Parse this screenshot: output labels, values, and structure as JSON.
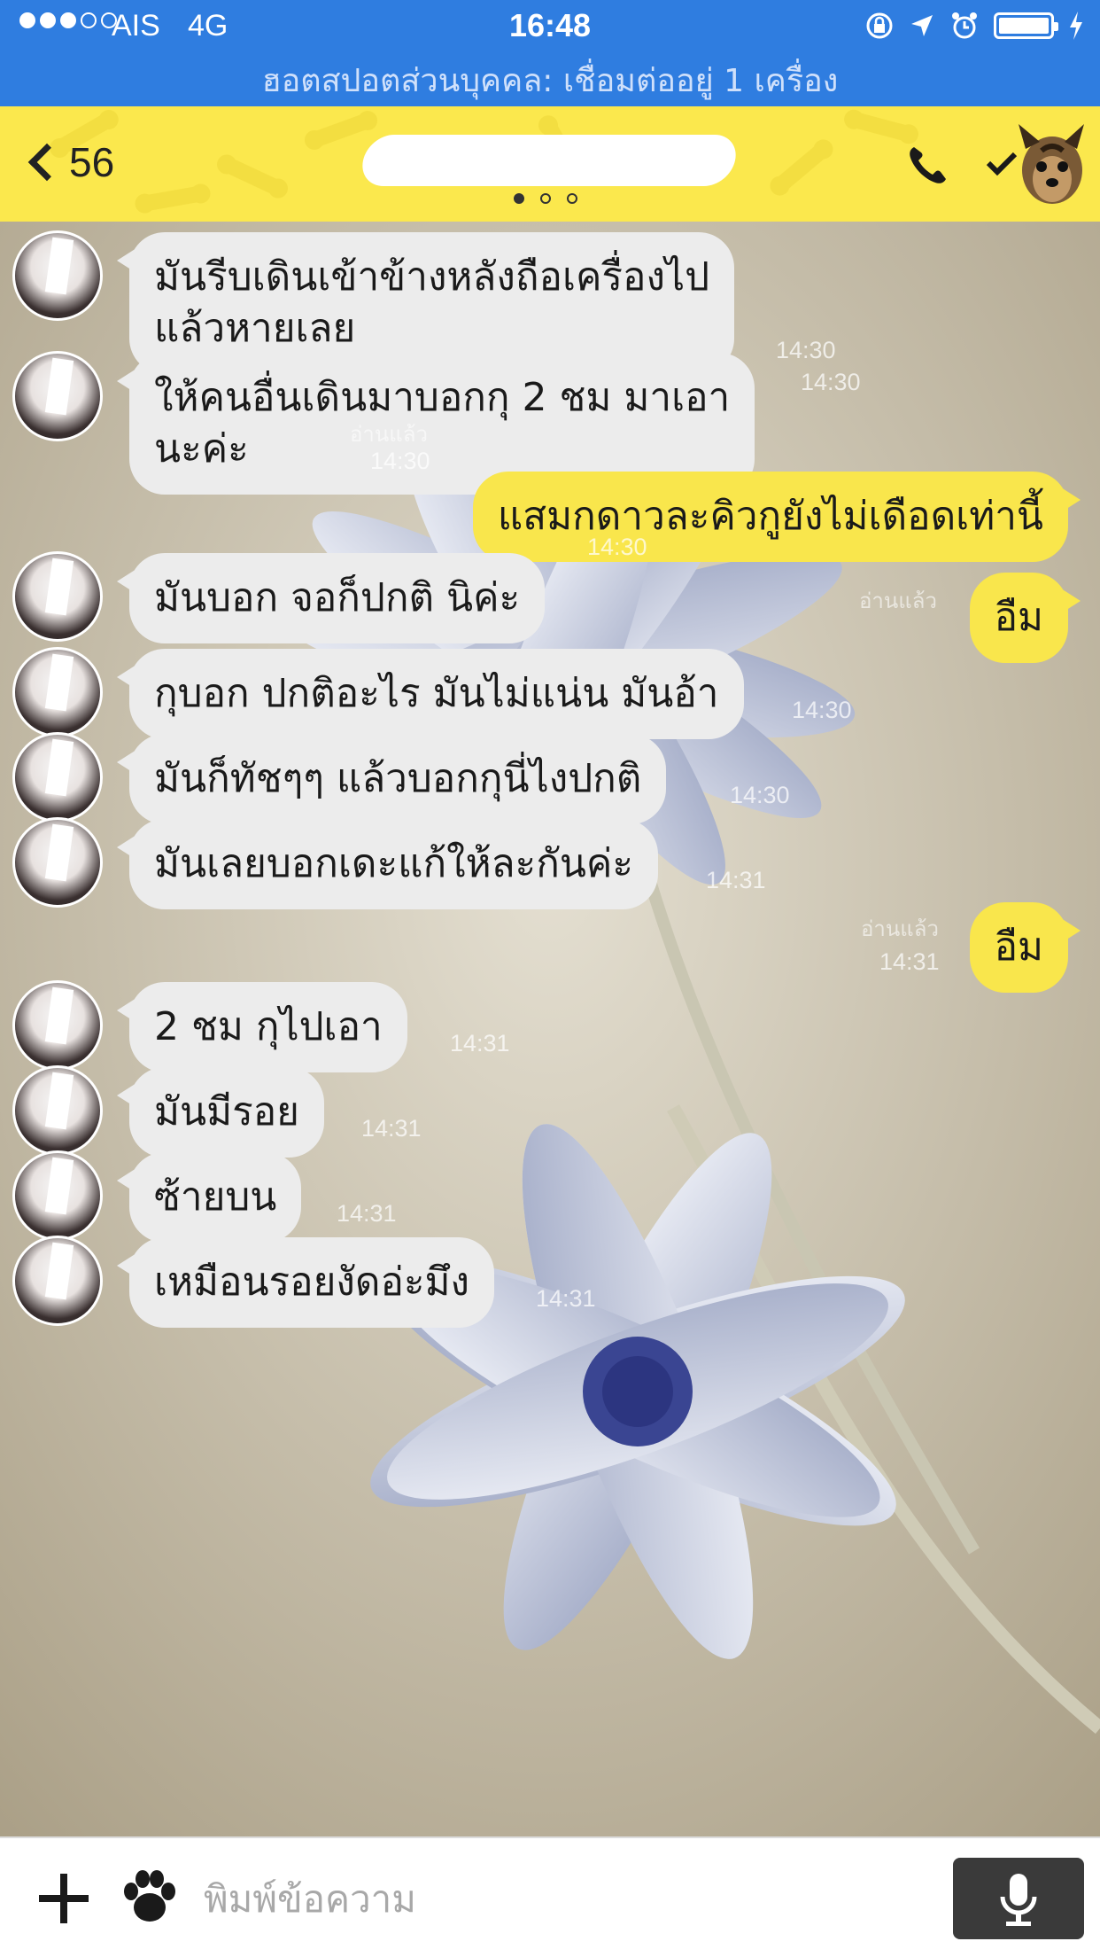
{
  "status_bar": {
    "signal_dots": [
      true,
      true,
      true,
      false,
      false
    ],
    "carrier": "AIS",
    "network": "4G",
    "time": "16:48",
    "battery_level": 1.0,
    "hotspot_text": "ฮอตสปอตส่วนบุคคล: เชื่อมต่ออยู่ 1 เครื่อง"
  },
  "header": {
    "back_count": "56",
    "page_dot_count": 3,
    "active_page": 0
  },
  "messages": [
    {
      "side": "in",
      "lines": [
        "มันรีบเดินเข้าข้างหลังถือเครื่องไป",
        "แล้วหายเลย"
      ],
      "time": "14:30"
    },
    {
      "side": "in",
      "lines": [
        "ให้คนอื่นเดินมาบอกกุ 2 ชม มาเอา",
        "นะค่ะ"
      ],
      "time": "14:30"
    },
    {
      "side": "out",
      "lines": [
        "แสมกดาวละคิวกูยังไม่เดือดเท่านี้"
      ],
      "read": "อ่านแล้ว",
      "time": "14:30"
    },
    {
      "side": "in",
      "lines": [
        "มันบอก จอก็ปกติ นิค่ะ"
      ],
      "time": "14:30"
    },
    {
      "side": "out",
      "lines": [
        "อืม"
      ],
      "read": "อ่านแล้ว",
      "time": ""
    },
    {
      "side": "in",
      "lines": [
        "กุบอก ปกติอะไร มันไม่แน่น มันอ้า"
      ],
      "time": "14:30"
    },
    {
      "side": "in",
      "lines": [
        "มันก็ทัชๆๆ แล้วบอกกุนี่ไงปกติ"
      ],
      "time": "14:30"
    },
    {
      "side": "in",
      "lines": [
        "มันเลยบอกเดะแก้ให้ละกันค่ะ"
      ],
      "time": "14:31"
    },
    {
      "side": "out",
      "lines": [
        "อืม"
      ],
      "read": "อ่านแล้ว",
      "time": "14:31"
    },
    {
      "side": "in",
      "lines": [
        "2 ชม กุไปเอา"
      ],
      "time": "14:31"
    },
    {
      "side": "in",
      "lines": [
        "มันมีรอย"
      ],
      "time": "14:31"
    },
    {
      "side": "in",
      "lines": [
        "ซ้ายบน"
      ],
      "time": "14:31"
    },
    {
      "side": "in",
      "lines": [
        "เหมือนรอยงัดอ่ะมึง"
      ],
      "time": "14:31"
    }
  ],
  "input": {
    "placeholder": "พิมพ์ข้อความ",
    "value": ""
  },
  "icons": {
    "back": "chevron-left-icon",
    "call": "phone-icon",
    "menu": "check-dropdown-icon",
    "attach": "plus-icon",
    "sticker": "paw-icon",
    "voice": "microphone-icon"
  },
  "colors": {
    "status_bar_bg": "#2f7de0",
    "header_bg": "#fbe84d",
    "incoming_bubble": "#ececec",
    "outgoing_bubble": "#f9e64c"
  }
}
